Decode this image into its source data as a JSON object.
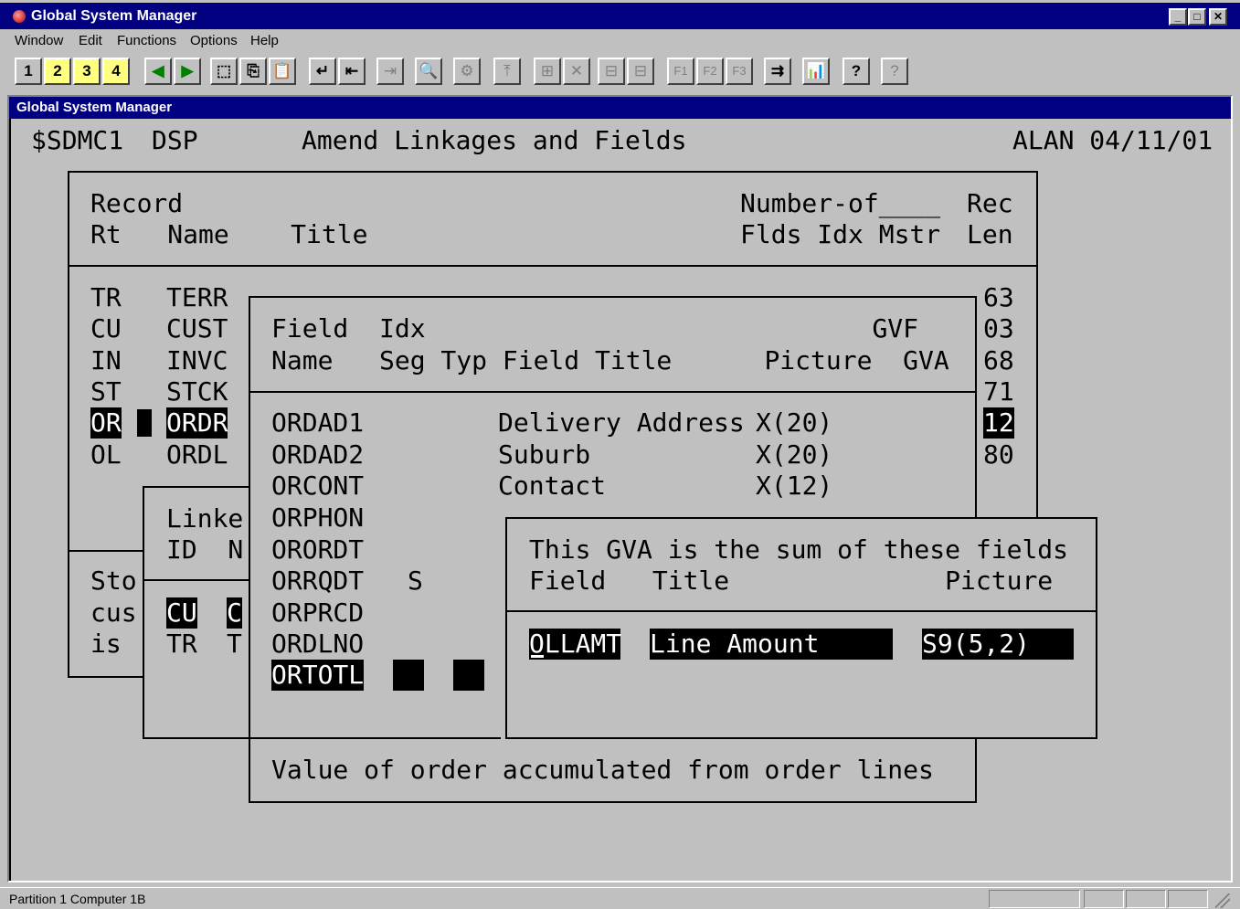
{
  "window": {
    "title": "Global System Manager",
    "inner_title": "Global System Manager",
    "controls": [
      "_",
      "□",
      "✕"
    ]
  },
  "menu": [
    {
      "label": "Window",
      "mnemonic": "W"
    },
    {
      "label": "Edit",
      "mnemonic": "E"
    },
    {
      "label": "Functions",
      "mnemonic": "F"
    },
    {
      "label": "Options",
      "mnemonic": "O"
    },
    {
      "label": "Help",
      "mnemonic": "H"
    }
  ],
  "toolbar": {
    "buttons": [
      "1",
      "2",
      "3",
      "4",
      "◀",
      "▶",
      "⬚",
      "⎘",
      "📋",
      "↵",
      "⇤",
      "⇥",
      "🔍",
      "⚙",
      "⤒",
      "⊞",
      "✕",
      "⊟",
      "⊟",
      "F1",
      "F2",
      "F3",
      "⇉",
      "📊",
      "?",
      "?"
    ]
  },
  "header": {
    "program": "$SDMC1",
    "mode": "DSP",
    "title": "Amend Linkages and Fields",
    "user_date": "ALAN 04/11/01"
  },
  "records": {
    "header_line1": "Record",
    "header_line2": "Rt   Name    Title",
    "numof_line1": "Number-of____",
    "numof_line2": "Flds Idx Mstr",
    "rec_line1": "Rec",
    "rec_line2": "Len",
    "rows": [
      {
        "rt": "TR",
        "name": "TERR",
        "len": "63"
      },
      {
        "rt": "CU",
        "name": "CUST",
        "len": "03"
      },
      {
        "rt": "IN",
        "name": "INVC",
        "len": "68"
      },
      {
        "rt": "ST",
        "name": "STCK",
        "len": "71"
      },
      {
        "rt": "OR",
        "name": "ORDR",
        "len": "12"
      },
      {
        "rt": "OL",
        "name": "ORDL",
        "len": "80"
      }
    ]
  },
  "store_text": [
    "Sto",
    "cus",
    "is"
  ],
  "linkages": {
    "header1": "Linke",
    "header2": "ID  N",
    "rows": [
      {
        "id": "CU",
        "n": "C"
      },
      {
        "id": "TR",
        "n": "T"
      }
    ]
  },
  "fields": {
    "header1": "Field  Idx                             GVF",
    "header2": "Name   Seg Typ Field Title      Picture  GVA",
    "rows": [
      {
        "name": "ORDAD1",
        "seg": "",
        "title": "Delivery Address",
        "picture": "X(20)"
      },
      {
        "name": "ORDAD2",
        "seg": "",
        "title": "Suburb",
        "picture": "X(20)"
      },
      {
        "name": "ORCONT",
        "seg": "",
        "title": "Contact",
        "picture": "X(12)"
      },
      {
        "name": "ORPHON",
        "seg": "",
        "title": "",
        "picture": ""
      },
      {
        "name": "ORORDT",
        "seg": "",
        "title": "",
        "picture": ""
      },
      {
        "name": "ORRQDT",
        "seg": "S",
        "title": "",
        "picture": ""
      },
      {
        "name": "ORPRCD",
        "seg": "",
        "title": "",
        "picture": ""
      },
      {
        "name": "ORDLNO",
        "seg": "",
        "title": "",
        "picture": ""
      },
      {
        "name": "ORTOTL",
        "seg": "",
        "title": "",
        "picture": ""
      }
    ],
    "description": "Value of order accumulated from order lines"
  },
  "gva": {
    "caption": "This GVA is the sum of these fields",
    "header": "Field   Title              Picture",
    "field": "OLLAMT",
    "title": "Line Amount",
    "picture": "S9(5,2)"
  },
  "status": {
    "text": "Partition 1 Computer 1B"
  }
}
